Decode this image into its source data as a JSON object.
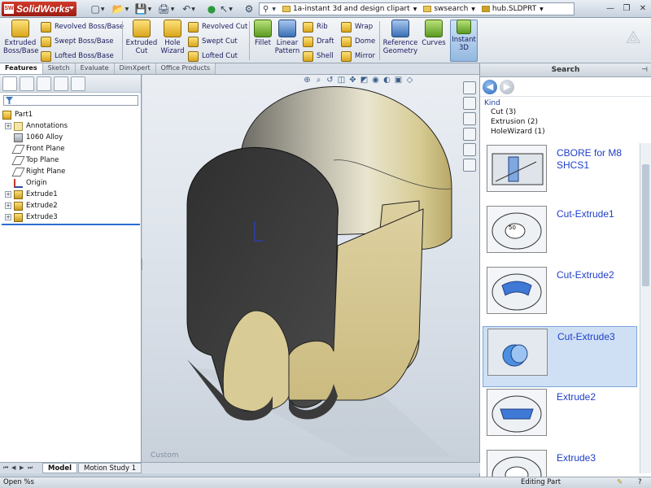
{
  "app": {
    "title": "SolidWorks",
    "logo_badge": "SW"
  },
  "quick_toolbar": [
    "new-document-icon",
    "open-folder-icon",
    "save-icon",
    "print-icon",
    "undo-icon",
    "rebuild-traffic-light-icon",
    "select-icon",
    "file-properties-icon",
    "options-gear-icon"
  ],
  "breadcrumbs": [
    "1a-instant 3d and design clipart",
    "swsearch",
    "hub.SLDPRT"
  ],
  "command_manager": {
    "big": [
      {
        "label": "Extruded\nBoss/Base"
      },
      {
        "label": "Extruded\nCut"
      },
      {
        "label": "Hole\nWizard"
      },
      {
        "label": "Fillet"
      },
      {
        "label": "Linear\nPattern"
      },
      {
        "label": "Reference\nGeometry"
      },
      {
        "label": "Curves"
      },
      {
        "label": "Instant\n3D"
      }
    ],
    "small": {
      "revolved_boss": "Revolved Boss/Base",
      "swept_boss": "Swept Boss/Base",
      "lofted_boss": "Lofted Boss/Base",
      "revolved_cut": "Revolved Cut",
      "swept_cut": "Swept Cut",
      "lofted_cut": "Lofted Cut",
      "rib": "Rib",
      "draft": "Draft",
      "shell": "Shell",
      "wrap": "Wrap",
      "dome": "Dome",
      "mirror": "Mirror"
    },
    "tabs": [
      "Features",
      "Sketch",
      "Evaluate",
      "DimXpert",
      "Office Products"
    ]
  },
  "feature_tree": {
    "root": "Part1",
    "nodes": [
      {
        "label": "Annotations",
        "icon": "annotations-icon",
        "expandable": true
      },
      {
        "label": "1060 Alloy",
        "icon": "material-icon",
        "expandable": false
      },
      {
        "label": "Front Plane",
        "icon": "plane-icon",
        "expandable": false
      },
      {
        "label": "Top Plane",
        "icon": "plane-icon",
        "expandable": false
      },
      {
        "label": "Right Plane",
        "icon": "plane-icon",
        "expandable": false
      },
      {
        "label": "Origin",
        "icon": "origin-icon",
        "expandable": false
      },
      {
        "label": "Extrude1",
        "icon": "extrude-icon",
        "expandable": true
      },
      {
        "label": "Extrude2",
        "icon": "extrude-icon",
        "expandable": true
      },
      {
        "label": "Extrude3",
        "icon": "extrude-icon",
        "expandable": true
      }
    ]
  },
  "viewport": {
    "view_label": "Custom"
  },
  "search_pane": {
    "title": "Search",
    "kind_title": "Kind",
    "kinds": [
      "Cut (3)",
      "Extrusion (2)",
      "HoleWizard (1)"
    ],
    "results": [
      {
        "label": "CBORE for M8 SHCS1",
        "selected": false
      },
      {
        "label": "Cut-Extrude1",
        "selected": false
      },
      {
        "label": "Cut-Extrude2",
        "selected": false
      },
      {
        "label": "Cut-Extrude3",
        "selected": true
      },
      {
        "label": "Extrude2",
        "selected": false
      },
      {
        "label": "Extrude3",
        "selected": false
      }
    ]
  },
  "bottom_tabs": [
    "Model",
    "Motion Study 1"
  ],
  "status": {
    "left": "Open %s",
    "right": "Editing Part"
  },
  "colors": {
    "part_face": "#d6c892",
    "part_dark": "#3b3b3b",
    "accent": "#1f3fc8",
    "selection": "#cfe0f5"
  }
}
